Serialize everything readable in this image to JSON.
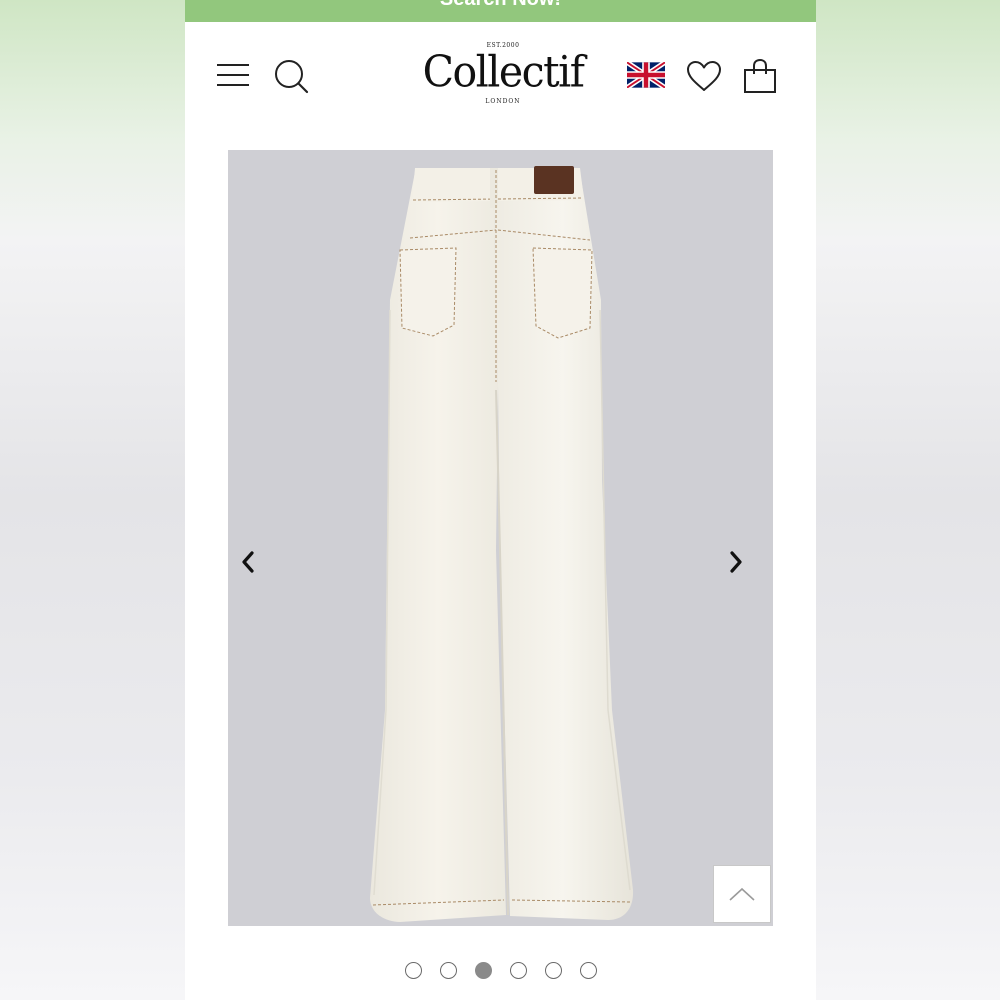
{
  "promo": {
    "text": "Search Now!"
  },
  "header": {
    "logo": {
      "est": "EST.2000",
      "name": "Collectif",
      "location": "LONDON"
    },
    "icons": [
      "menu-icon",
      "search-icon",
      "uk-flag-icon",
      "heart-icon",
      "shopping-bag-icon"
    ]
  },
  "colors": {
    "banner": "#92c77d",
    "gallery_background": "#cfcfd4",
    "garment": "#f4f1e8",
    "stitching": "#a98a66",
    "label_patch": "#5a3322"
  },
  "gallery": {
    "product_image": "white-flared-jeans-back-view",
    "prev_icon": "chevron-left-icon",
    "next_icon": "chevron-right-icon",
    "current_index": 3,
    "total_images": 6,
    "dots": [
      false,
      false,
      true,
      false,
      false,
      false
    ]
  },
  "back_to_top": {
    "icon": "chevron-up-icon"
  }
}
